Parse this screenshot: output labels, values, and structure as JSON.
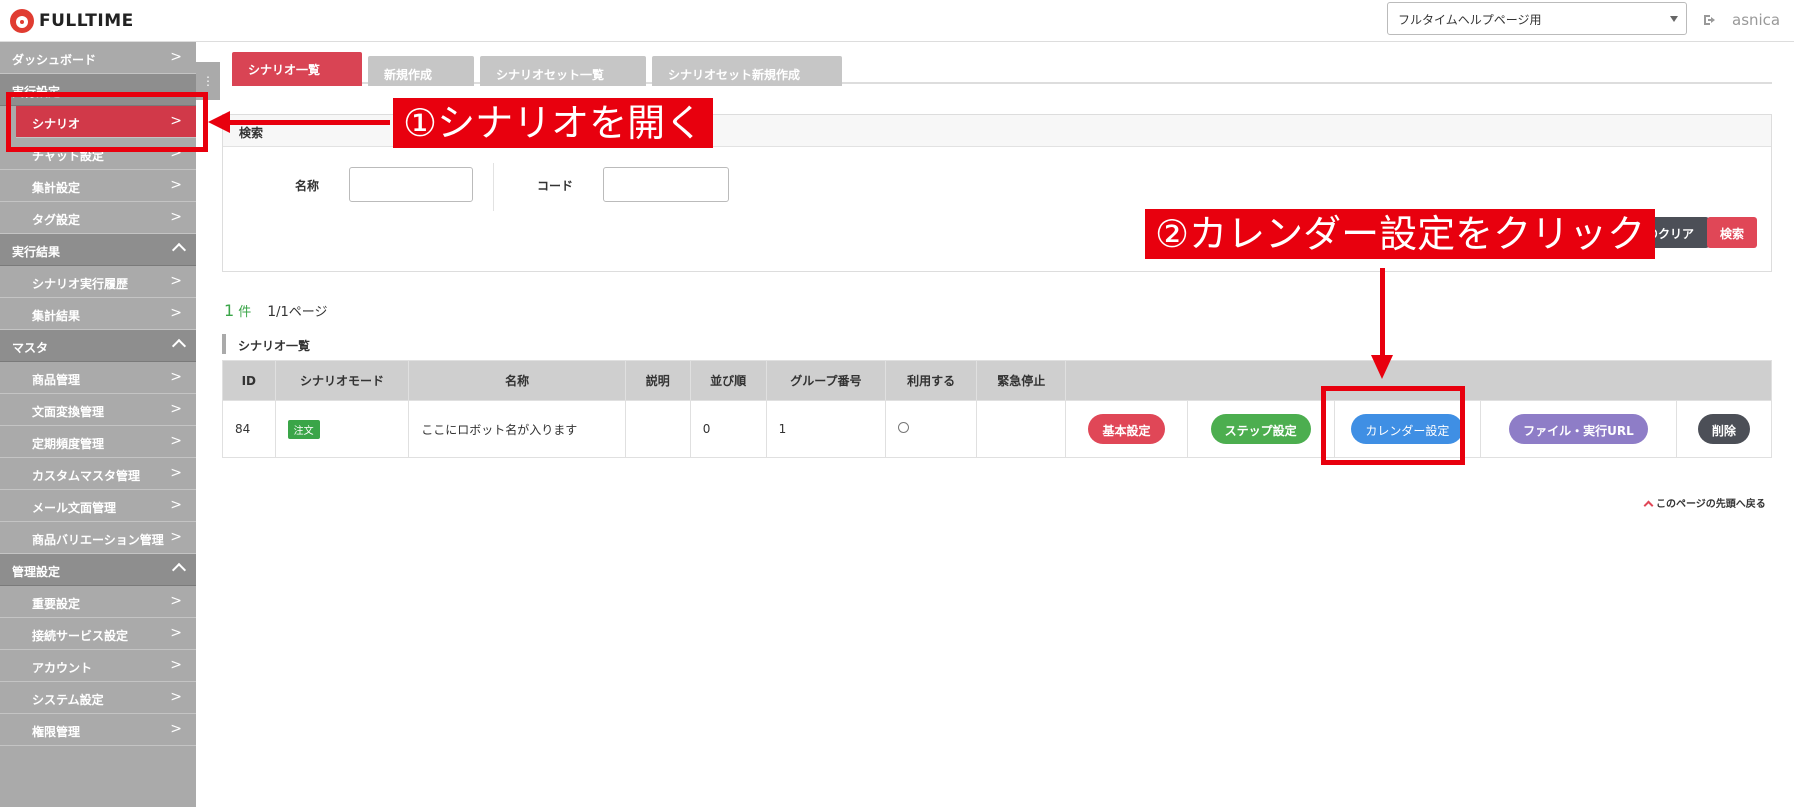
{
  "header": {
    "logo_text": "FULLTIME",
    "site_select": "フルタイムヘルプページ用",
    "logout_icon": "logout-icon",
    "username": "asnica"
  },
  "sidebar": {
    "dashboard": "ダッシュボード",
    "section_exec_settings": "実行設定",
    "scenario": "シナリオ",
    "chat_settings": "チャット設定",
    "aggregate_settings": "集計設定",
    "tag_settings": "タグ設定",
    "section_results": "実行結果",
    "scenario_history": "シナリオ実行履歴",
    "aggregate_results": "集計結果",
    "section_master": "マスタ",
    "product_mgmt": "商品管理",
    "text_conversion": "文面変換管理",
    "periodic_frequency": "定期頻度管理",
    "custom_master": "カスタムマスタ管理",
    "mail_text": "メール文面管理",
    "product_variation": "商品バリエーション管理",
    "section_admin": "管理設定",
    "important_settings": "重要設定",
    "connection_service": "接続サービス設定",
    "account": "アカウント",
    "system_settings": "システム設定",
    "permission_mgmt": "権限管理",
    "chevron": ">"
  },
  "tabs": [
    "シナリオ一覧",
    "新規作成",
    "シナリオセット一覧",
    "シナリオセット新規作成"
  ],
  "search": {
    "title": "検索",
    "name_label": "名称",
    "code_label": "コード",
    "clear_button": "件のクリア",
    "search_button": "検索"
  },
  "results": {
    "count": "1",
    "count_unit": "件",
    "page_current": "1",
    "page_total": "/1ページ",
    "list_title": "シナリオ一覧"
  },
  "table": {
    "headers": [
      "ID",
      "シナリオモード",
      "名称",
      "説明",
      "並び順",
      "グループ番号",
      "利用する",
      "緊急停止"
    ],
    "row": {
      "id": "84",
      "mode": "注文",
      "name": "ここにロボット名が入ります",
      "description": "",
      "order": "0",
      "group": "1",
      "emergency": ""
    },
    "buttons": {
      "basic": "基本設定",
      "step": "ステップ設定",
      "calendar": "カレンダー設定",
      "file": "ファイル・実行URL",
      "delete": "削除"
    }
  },
  "back_to_top": "このページの先頭へ戻る",
  "annotations": {
    "step1": "①シナリオを開く",
    "step2": "②カレンダー設定をクリック"
  },
  "colors": {
    "accent_red": "#d94454",
    "annotation_red": "#e8000e",
    "green": "#3aa548",
    "blue": "#3f8fe4",
    "sidebar_gray": "#aaaaaa"
  }
}
